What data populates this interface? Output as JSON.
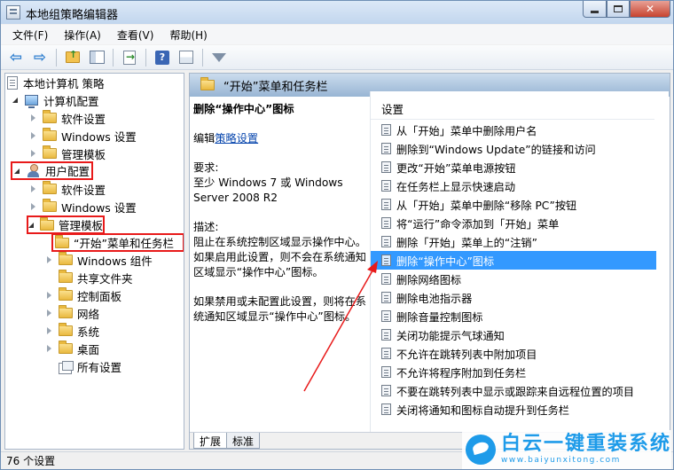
{
  "window": {
    "title": "本地组策略编辑器"
  },
  "menu": [
    "文件(F)",
    "操作(A)",
    "查看(V)",
    "帮助(H)"
  ],
  "tree": {
    "root": "本地计算机 策略",
    "computer_config": "计算机配置",
    "cc_software": "软件设置",
    "cc_windows": "Windows 设置",
    "cc_admin": "管理模板",
    "user_config": "用户配置",
    "uc_software": "软件设置",
    "uc_windows": "Windows 设置",
    "uc_admin": "管理模板",
    "start_taskbar": "“开始”菜单和任务栏",
    "windows_components": "Windows 组件",
    "shared_folders": "共享文件夹",
    "control_panel": "控制面板",
    "network": "网络",
    "system": "系统",
    "desktop": "桌面",
    "all_settings": "所有设置"
  },
  "right_header": "“开始”菜单和任务栏",
  "description": {
    "title": "删除“操作中心”图标",
    "edit_prefix": "编辑",
    "edit_link": "策略设置",
    "requirements_label": "要求:",
    "requirements_text": "至少 Windows 7 或 Windows Server 2008 R2",
    "desc_label": "描述:",
    "desc_text": " 阻止在系统控制区域显示操作中心。如果启用此设置，则不会在系统通知区域显示“操作中心”图标。",
    "desc_text2": "如果禁用或未配置此设置，则将在系统通知区域显示“操作中心”图标。"
  },
  "list": {
    "column": "设置",
    "items": [
      "从「开始」菜单中删除用户名",
      "删除到“Windows Update”的链接和访问",
      "更改“开始”菜单电源按钮",
      "在任务栏上显示快速启动",
      "从「开始」菜单中删除“移除 PC”按钮",
      "将“运行”命令添加到「开始」菜单",
      "删除「开始」菜单上的“注销”",
      "删除“操作中心”图标",
      "删除网络图标",
      "删除电池指示器",
      "删除音量控制图标",
      "关闭功能提示气球通知",
      "不允许在跳转列表中附加项目",
      "不允许将程序附加到任务栏",
      "不要在跳转列表中显示或跟踪来自远程位置的项目",
      "关闭将通知和图标自动提升到任务栏"
    ],
    "selected_index": 7
  },
  "tabs": [
    "扩展",
    "标准"
  ],
  "status": "76 个设置",
  "watermark": {
    "title": "白云一键重装系统",
    "url": "www.baiyunxitong.com"
  },
  "colors": {
    "highlight": "#3399ff",
    "annotation_red": "#e81a1a",
    "header_blue": "#98b5d4"
  }
}
